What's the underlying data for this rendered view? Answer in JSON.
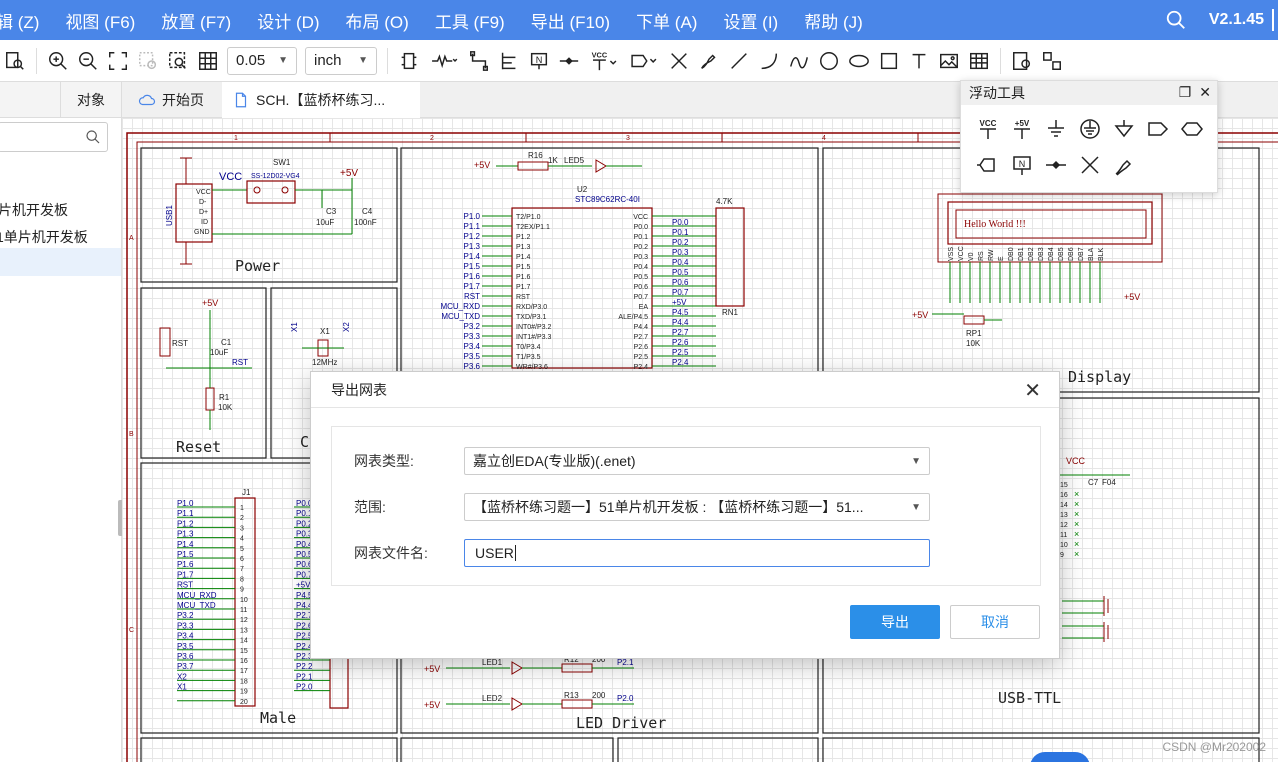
{
  "menu": {
    "items": [
      "辑 (Z)",
      "视图 (F6)",
      "放置 (F7)",
      "设计 (D)",
      "布局 (O)",
      "工具 (F9)",
      "导出 (F10)",
      "下单 (A)",
      "设置 (I)",
      "帮助 (J)"
    ],
    "version": "V2.1.45"
  },
  "toolbar": {
    "grid_size": "0.05",
    "unit": "inch",
    "vcc_label": "VCC"
  },
  "left_panel": {
    "tab_object": "对象",
    "items": [
      "片机开发板",
      "1单片机开发板"
    ]
  },
  "doc_tabs": {
    "home": "开始页",
    "sch": "SCH.【蓝桥杯练习..."
  },
  "float_panel": {
    "title": "浮动工具",
    "vcc_label": "VCC",
    "plus5v_label": "+5V",
    "n_label": "N"
  },
  "schematic": {
    "blocks": {
      "power": "Power",
      "reset": "Reset",
      "crystal_partial": "C",
      "display": "Display",
      "male": "Male",
      "led_driver": "LED Driver",
      "usb_ttl": "USB-TTL"
    },
    "ruler": [
      "1",
      "2",
      "3",
      "4"
    ],
    "rows": [
      "A",
      "B",
      "C"
    ],
    "parts": {
      "usb1": "USB1",
      "sw1": "SW1",
      "sw_part": "SS-12D02-VG4",
      "vcc": "VCC",
      "plus5v": "+5V",
      "c3": "C3",
      "c3_val": "10uF",
      "c4": "C4",
      "c4_val": "100nF",
      "usb_pins": [
        "VCC",
        "D-",
        "D+",
        "ID",
        "GND"
      ],
      "r16": "R16",
      "r16_val": "1K",
      "led5": "LED5",
      "u2": "U2",
      "u2_part": "STC89C62RC-40I",
      "rn1": "RN1",
      "rn1_val": "4.7K",
      "lcd_text": "Hello World !!!",
      "rp1": "RP1",
      "rp1_val": "10K",
      "rst": "RST",
      "c1": "C1",
      "c1_val": "10uF",
      "r1": "R1",
      "r1_val": "10K",
      "x1": "X1",
      "x2": "X2",
      "x1_val": "12MHz",
      "j1": "J1",
      "led1": "LED1",
      "led2": "LED2",
      "r13": "R13",
      "r13_val": "200",
      "r12": "R12",
      "r12_val": "200",
      "p21": "P2.1",
      "p20": "P2.0",
      "c7": "C7",
      "c7_val": "F04",
      "mcu_left": [
        "P1.0",
        "P1.1",
        "P1.2",
        "P1.3",
        "P1.4",
        "P1.5",
        "P1.6",
        "P1.7",
        "RST",
        "MCU_RXD",
        "MCU_TXD",
        "P3.2",
        "P3.3",
        "P3.4",
        "P3.5",
        "P3.6"
      ],
      "mcu_pins_left": [
        "T2/P1.0",
        "T2EX/P1.1",
        "P1.2",
        "P1.3",
        "P1.4",
        "P1.5",
        "P1.6",
        "P1.7",
        "RST",
        "RXD/P3.0",
        "TXD/P3.1",
        "INT0#/P3.2",
        "INT1#/P3.3",
        "T0/P3.4",
        "T1/P3.5",
        "WR#/P3.6"
      ],
      "mcu_pins_right": [
        "VCC",
        "P0.0",
        "P0.1",
        "P0.2",
        "P0.3",
        "P0.4",
        "P0.5",
        "P0.6",
        "P0.7",
        "EA",
        "ALE/P4.5",
        "P4.4",
        "P2.7",
        "P2.6",
        "P2.5",
        "P2.4"
      ],
      "mcu_right_nets": [
        "P0.0",
        "P0.1",
        "P0.2",
        "P0.3",
        "P0.4",
        "P0.5",
        "P0.6",
        "P0.7",
        "+5V",
        "P4.5",
        "P4.4",
        "P2.7",
        "P2.6",
        "P2.5",
        "P2.4"
      ],
      "j1_left_nets": [
        "P1.0",
        "P1.1",
        "P1.2",
        "P1.3",
        "P1.4",
        "P1.5",
        "P1.6",
        "P1.7",
        "RST",
        "MCU_RXD",
        "MCU_TXD",
        "P3.2",
        "P3.3",
        "P3.4",
        "P3.5",
        "P3.6",
        "P3.7",
        "X2",
        "X1",
        ""
      ],
      "j1_right_nets": [
        "P0.0",
        "P0.1",
        "P0.2",
        "P0.3",
        "P0.4",
        "P0.5",
        "P0.6",
        "P0.7",
        "+5V",
        "P4.5",
        "P4.4",
        "P2.7",
        "P2.6",
        "P2.5",
        "P2.4",
        "P2.3",
        "P2.2",
        "P2.1",
        "P2.0"
      ],
      "lcd_pins": [
        "VSS",
        "VCC",
        "V0",
        "RS",
        "RW",
        "E",
        "DB0",
        "DB1",
        "DB2",
        "DB3",
        "DB4",
        "DB5",
        "DB6",
        "DB7",
        "BLA",
        "BLK"
      ]
    }
  },
  "dialog": {
    "title": "导出网表",
    "label_type": "网表类型:",
    "type_value": "嘉立创EDA(专业版)(.enet)",
    "label_scope": "范围:",
    "scope_value": "【蓝桥杯练习题一】51单片机开发板 : 【蓝桥杯练习题一】51...",
    "label_filename": "网表文件名:",
    "filename_value": "USER",
    "export_button": "导出",
    "cancel_button": "取消"
  },
  "watermark": "CSDN @Mr202002",
  "colors": {
    "menubar": "#4a86e8",
    "primary_button": "#2b8fe8",
    "schematic_frame": "#8b0000",
    "schematic_wire": "#008000",
    "schematic_net": "#00008b"
  }
}
